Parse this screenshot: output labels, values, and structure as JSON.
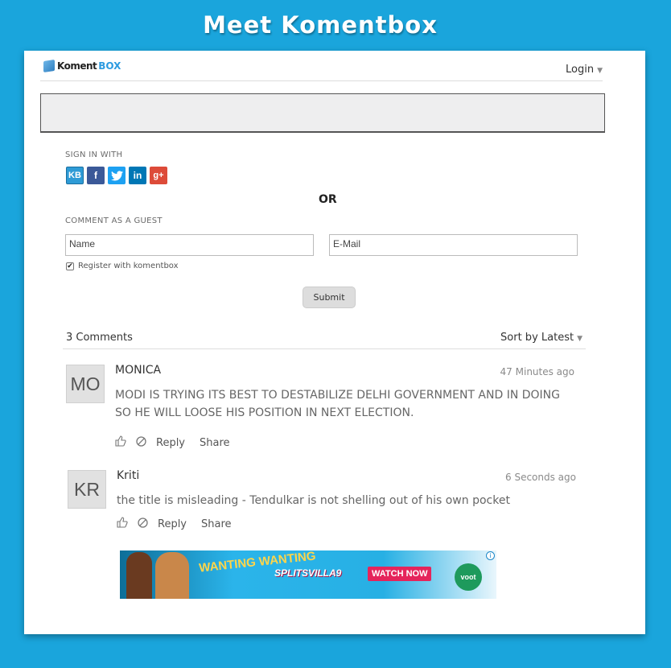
{
  "page": {
    "heading": "Meet Komentbox"
  },
  "header": {
    "logo_part1": "Koment",
    "logo_part2": "BOX",
    "login_label": "Login"
  },
  "signin": {
    "label": "SIGN IN WITH",
    "providers": [
      {
        "text": "KB",
        "icon": "komentbox-icon",
        "color": "#2e9bd6"
      },
      {
        "text": "f",
        "icon": "facebook-icon",
        "color": "#3b5998"
      },
      {
        "text": "t",
        "icon": "twitter-icon",
        "color": "#1da1f2"
      },
      {
        "text": "in",
        "icon": "linkedin-icon",
        "color": "#0077b5"
      },
      {
        "text": "g+",
        "icon": "google-plus-icon",
        "color": "#dd4b39"
      }
    ]
  },
  "or_label": "OR",
  "guest": {
    "label": "COMMENT AS A GUEST",
    "name_placeholder": "Name",
    "email_placeholder": "E-Mail",
    "register_label": "Register with komentbox",
    "register_checked": true,
    "submit_label": "Submit"
  },
  "comments_header": {
    "count_label": "3 Comments",
    "sort_label": "Sort by Latest"
  },
  "comments": [
    {
      "initials": "MO",
      "author": "MONICA",
      "time": "47 Minutes ago",
      "text": "MODI IS TRYING ITS BEST TO DESTABILIZE DELHI GOVERNMENT AND IN DOING SO HE WILL LOOSE HIS POSITION IN NEXT ELECTION.",
      "reply_label": "Reply",
      "share_label": "Share"
    },
    {
      "initials": "KR",
      "author": "Kriti",
      "time": "6 Seconds ago",
      "text": "the title is misleading - Tendulkar is not shelling out of his own pocket",
      "reply_label": "Reply",
      "share_label": "Share"
    }
  ],
  "ad": {
    "headline": "WANTING WANTING",
    "show": "SPLITSVILLA9",
    "cta": "WATCH NOW",
    "brand": "voot"
  },
  "colors": {
    "background": "#1aa5dc",
    "accent": "#2d9be0"
  }
}
